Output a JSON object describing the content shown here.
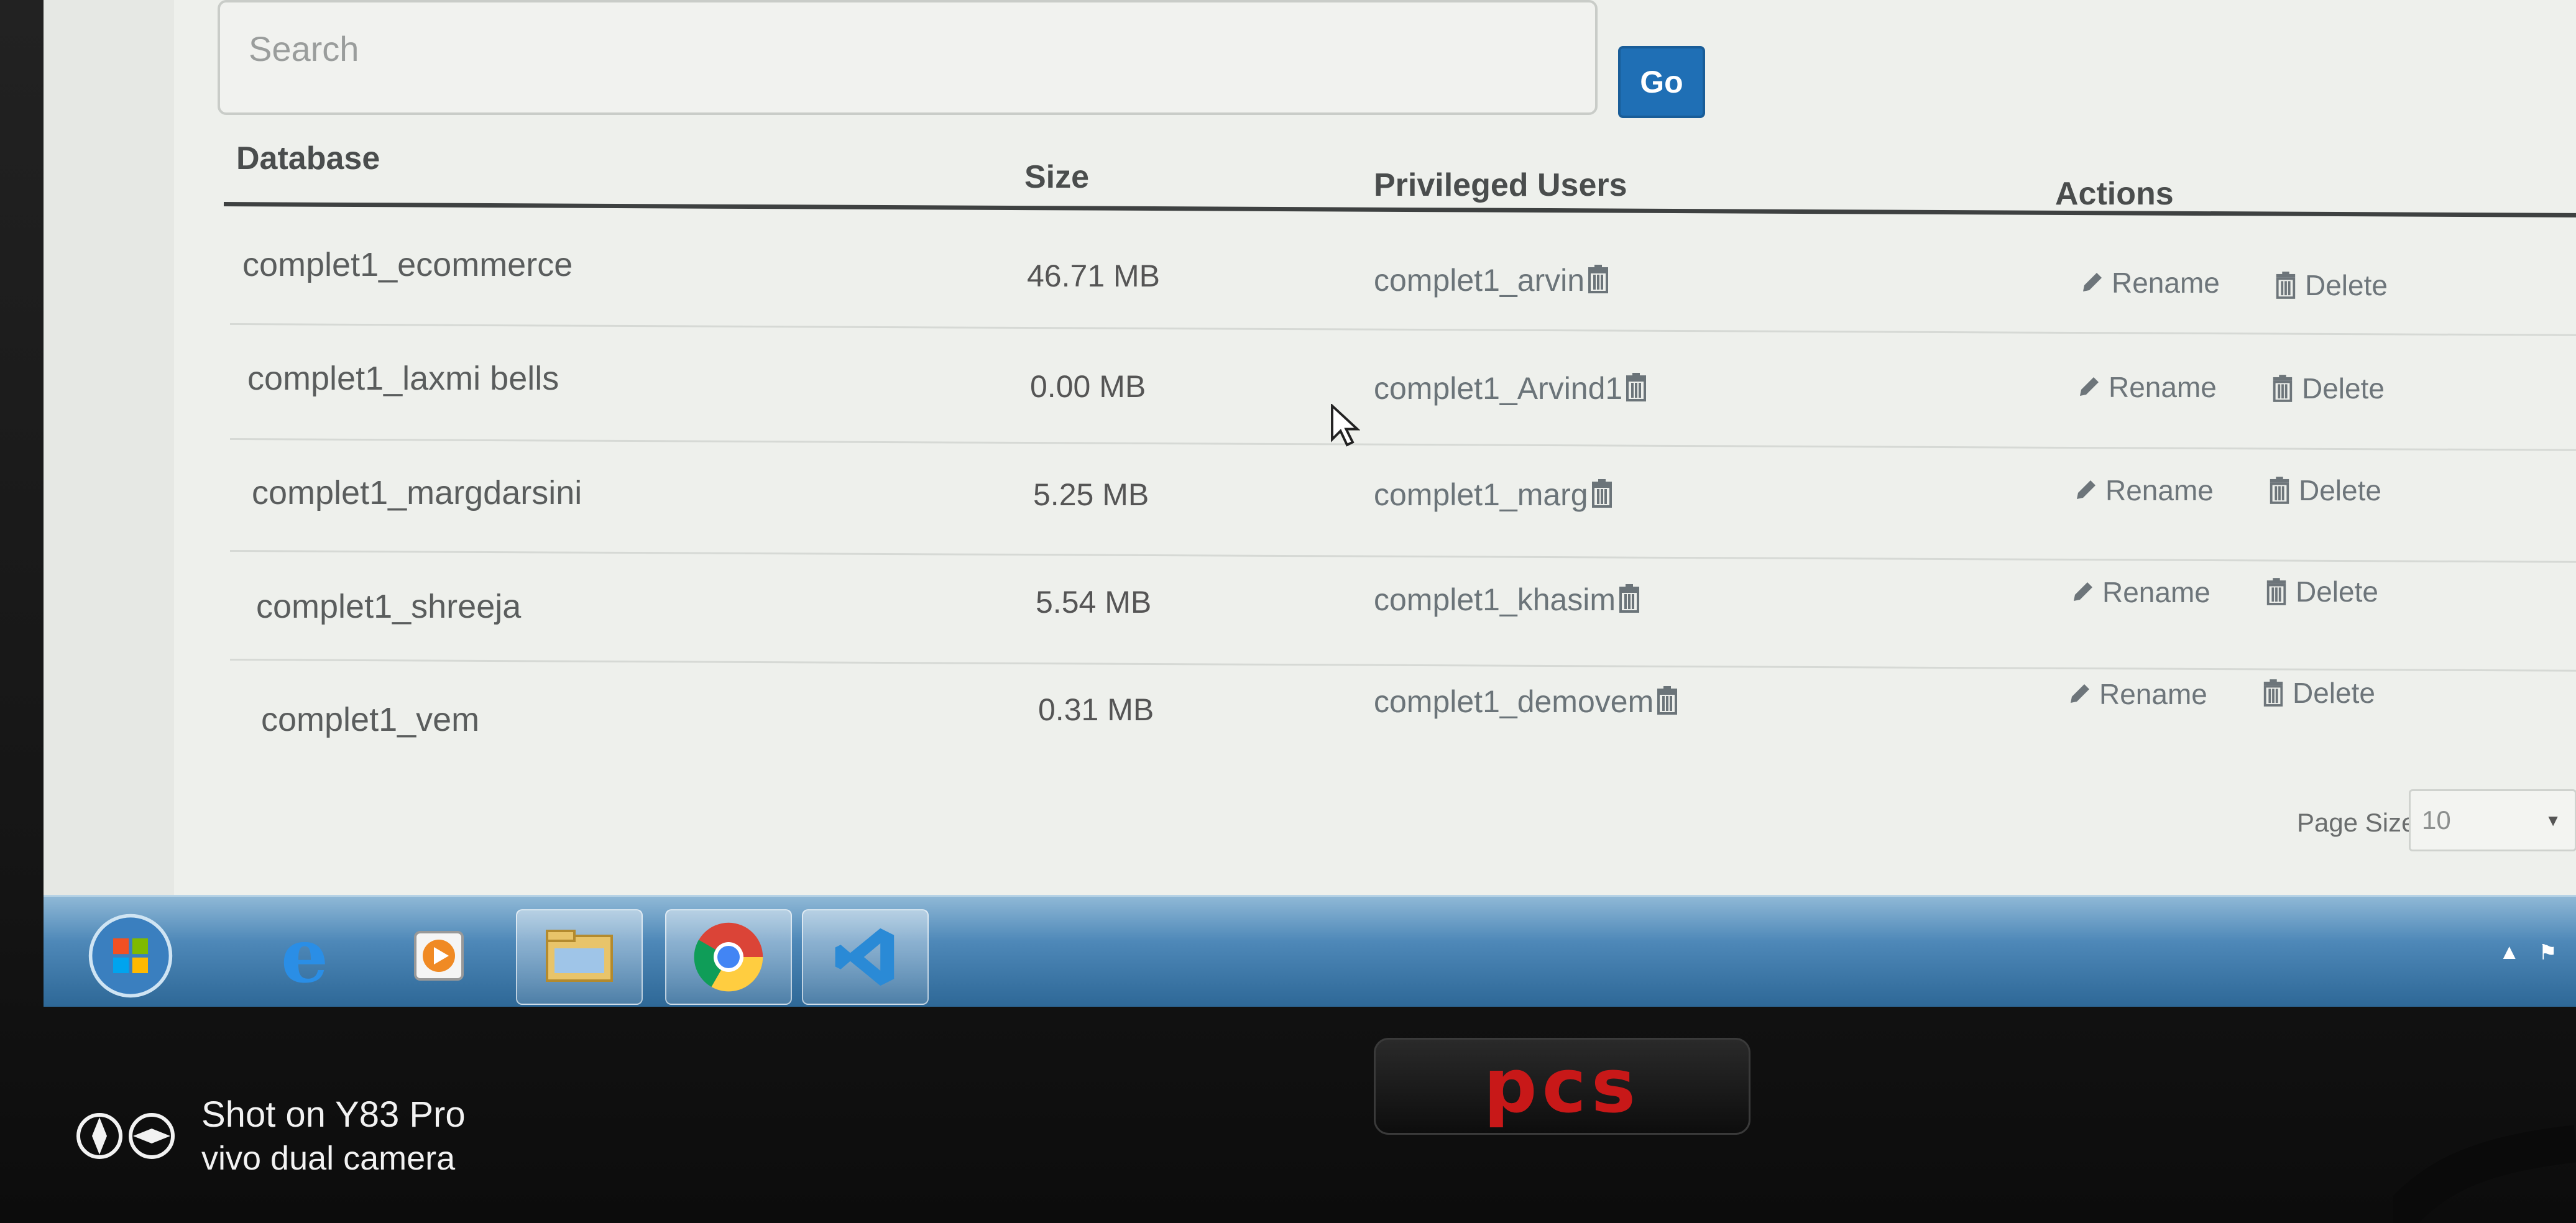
{
  "search": {
    "placeholder": "Search",
    "go_label": "Go"
  },
  "table": {
    "headers": {
      "database": "Database",
      "size": "Size",
      "users": "Privileged Users",
      "actions": "Actions"
    },
    "rows": [
      {
        "database": "complet1_ecommerce",
        "size": "46.71 MB",
        "user": "complet1_arvin"
      },
      {
        "database": "complet1_laxmi bells",
        "size": "0.00 MB",
        "user": "complet1_Arvind1"
      },
      {
        "database": "complet1_margdarsini",
        "size": "5.25 MB",
        "user": "complet1_marg"
      },
      {
        "database": "complet1_shreeja",
        "size": "5.54 MB",
        "user": "complet1_khasim"
      },
      {
        "database": "complet1_vem",
        "size": "0.31 MB",
        "user": "complet1_demovem"
      }
    ],
    "actions": {
      "rename": "Rename",
      "delete": "Delete"
    }
  },
  "pagination": {
    "page_size_label": "Page Size",
    "page_size_value": "10",
    "first_label": "<<"
  },
  "taskbar": {
    "items": [
      "start-button",
      "internet-explorer",
      "media-player",
      "file-explorer",
      "chrome",
      "visual-studio-code"
    ]
  },
  "monitor": {
    "brand": "pcs"
  },
  "watermark": {
    "line1": "Shot on Y83 Pro",
    "line2": "vivo dual camera"
  },
  "colors": {
    "accent": "#1f6fb5",
    "brand": "#c81818",
    "taskbar": "#4e88b8"
  }
}
